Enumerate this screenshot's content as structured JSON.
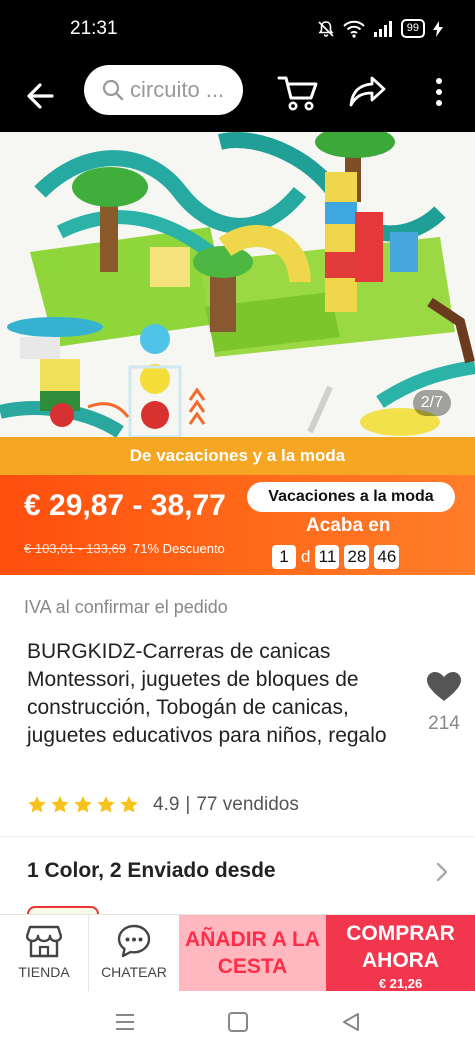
{
  "status": {
    "time": "21:31",
    "battery": "99"
  },
  "nav": {
    "search_placeholder": "circuito ..."
  },
  "gallery": {
    "counter": "2/7"
  },
  "promo": {
    "banner": "De vacaciones y a la moda",
    "price_range": "€ 29,87 - 38,77",
    "old_price": "€ 103,01 - 133,69",
    "discount": "71% Descuento",
    "campaign": "Vacaciones a la moda",
    "ends_label": "Acaba en",
    "countdown": {
      "days": "1",
      "days_unit": "d",
      "hours": "11",
      "minutes": "28",
      "seconds": "46"
    },
    "colors": {
      "banner": "#f5a623",
      "price_bg": "#ff5a14"
    }
  },
  "product": {
    "tax_note": "IVA al confirmar el pedido",
    "title": "BURGKIDZ-Carreras de canicas Montessori, juguetes de bloques de construcción, Tobogán de canicas, juguetes educativos para niños, regalo",
    "wishlist_count": "214",
    "rating": {
      "stars": 5,
      "value": "4.9",
      "separator": "|",
      "sold": "77 vendidos"
    },
    "variants": "1 Color, 2 Enviado desde"
  },
  "bottom_bar": {
    "store_label": "TIENDA",
    "chat_label": "CHATEAR",
    "add_to_cart": "AÑADIR A LA CESTA",
    "buy_now": "COMPRAR AHORA",
    "buy_price": "€ 21,26",
    "colors": {
      "cart_bg": "#ffb8c0",
      "buy_bg": "#f2364d"
    }
  }
}
